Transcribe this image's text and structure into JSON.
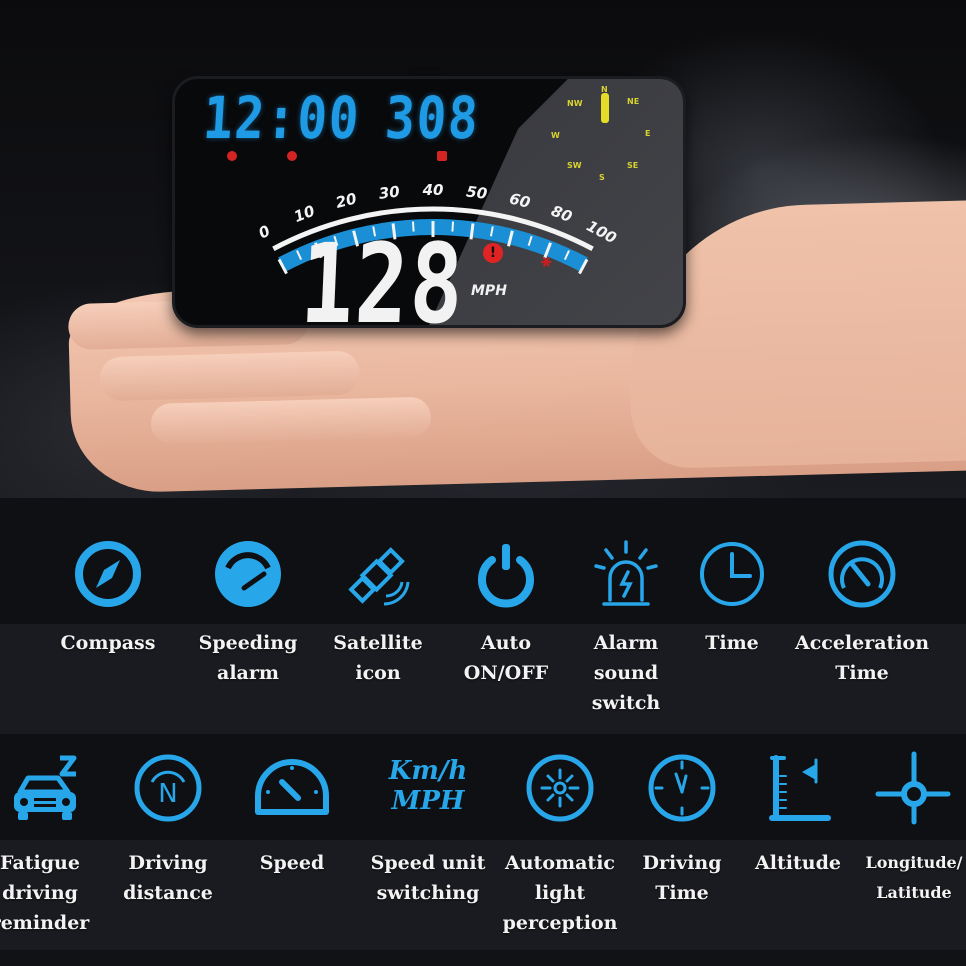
{
  "hud": {
    "time_display": "12:00",
    "altitude_display": "308",
    "speed_display": "128",
    "speed_unit": "MPH",
    "gauge_ticks": [
      "0",
      "10",
      "20",
      "30",
      "40",
      "50",
      "60",
      "80",
      "100"
    ],
    "compass_letters": [
      "N",
      "NE",
      "E",
      "SE",
      "S",
      "SW",
      "W",
      "NW"
    ],
    "warning_glyph": "!",
    "satellite_glyph": "✱",
    "colors": {
      "segment_blue": "#1f9be6",
      "segment_white": "#f2f2f2",
      "compass_yellow": "#d9d330",
      "alert_red": "#d42323",
      "gauge_blue": "#1a8fd6"
    }
  },
  "features_row1": [
    {
      "icon": "compass-icon",
      "label": "Compass"
    },
    {
      "icon": "speeding-alarm-icon",
      "label": "Speeding\nalarm"
    },
    {
      "icon": "satellite-icon",
      "label": "Satellite\nicon"
    },
    {
      "icon": "power-icon",
      "label": "Auto\nON/OFF"
    },
    {
      "icon": "alarm-siren-icon",
      "label": "Alarm\nsound\nswitch"
    },
    {
      "icon": "clock-icon",
      "label": "Time"
    },
    {
      "icon": "acceleration-gauge-icon",
      "label": "Acceleration\nTime"
    }
  ],
  "features_row2": [
    {
      "icon": "fatigue-car-icon",
      "label": "Fatigue\ndriving\nreminder"
    },
    {
      "icon": "driving-distance-icon",
      "label": "Driving\ndistance"
    },
    {
      "icon": "speedometer-icon",
      "label": "Speed"
    },
    {
      "icon": "speed-unit-icon",
      "label": "Speed unit\nswitching",
      "icon_text_top": "Km/h",
      "icon_text_bottom": "MPH"
    },
    {
      "icon": "light-sensor-icon",
      "label": "Automatic\nlight\nperception"
    },
    {
      "icon": "driving-time-icon",
      "label": "Driving\nTime"
    },
    {
      "icon": "altitude-icon",
      "label": "Altitude"
    },
    {
      "icon": "coordinates-icon",
      "label": "Longitude/\nLatitude"
    }
  ],
  "accent_color": "#27a6ea"
}
